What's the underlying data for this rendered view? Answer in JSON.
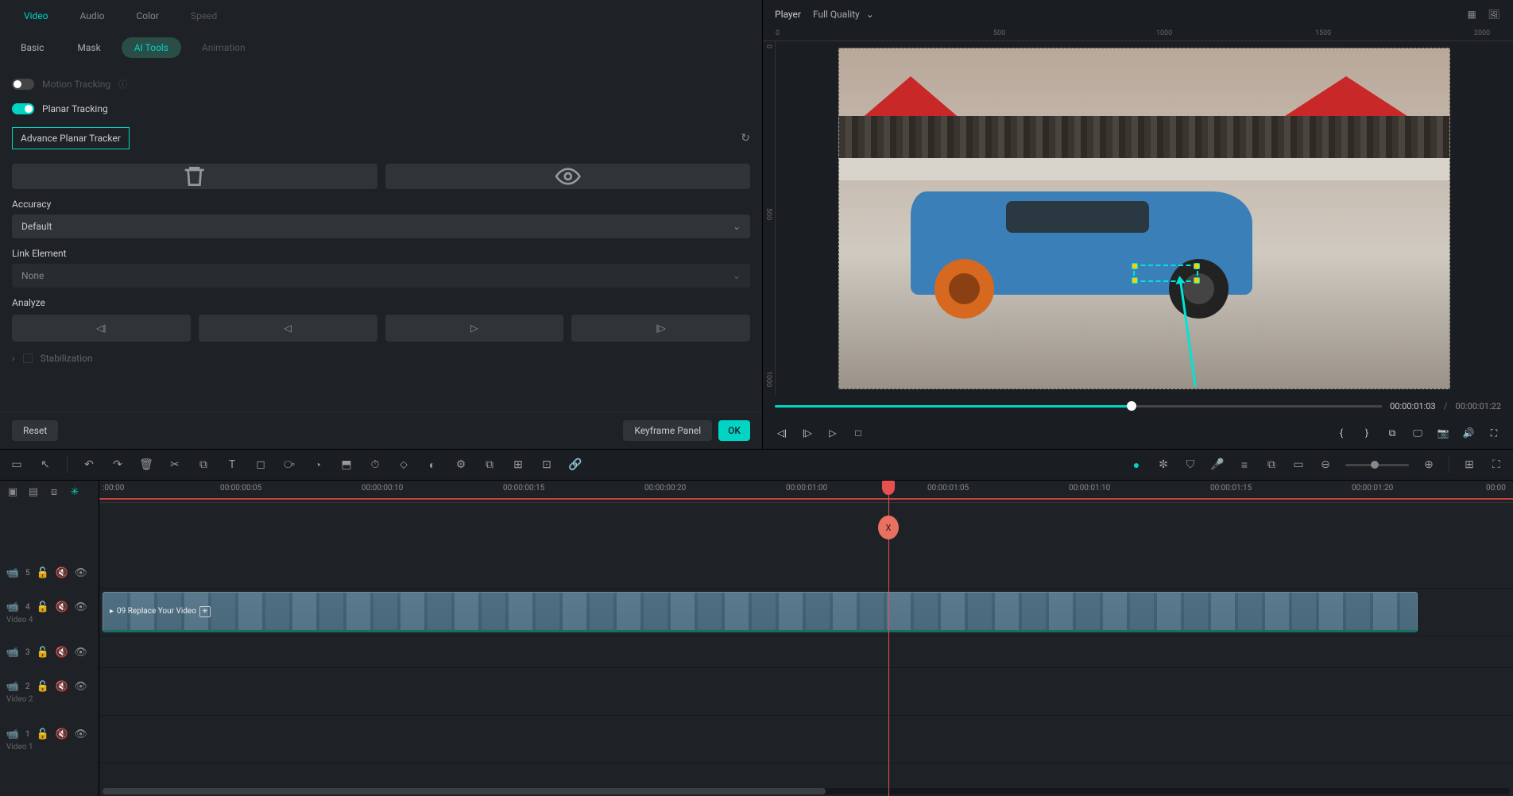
{
  "main_tabs": {
    "video": "Video",
    "audio": "Audio",
    "color": "Color",
    "speed": "Speed"
  },
  "sub_tabs": {
    "basic": "Basic",
    "mask": "Mask",
    "ai_tools": "AI Tools",
    "animation": "Animation"
  },
  "tracking": {
    "motion_label": "Motion Tracking",
    "planar_label": "Planar Tracking",
    "tracker_name": "Advance Planar Tracker"
  },
  "accuracy": {
    "label": "Accuracy",
    "value": "Default"
  },
  "link_element": {
    "label": "Link Element",
    "value": "None"
  },
  "analyze": {
    "label": "Analyze"
  },
  "stabilization": {
    "label": "Stabilization"
  },
  "footer": {
    "reset": "Reset",
    "keyframe_panel": "Keyframe Panel",
    "ok": "OK"
  },
  "player": {
    "label": "Player",
    "quality": "Full Quality",
    "current_time": "00:00:01:03",
    "total_time": "00:00:01:22"
  },
  "ruler_h": {
    "t0": "0",
    "t500": "500",
    "t1000": "1000",
    "t1500": "1500",
    "t2000": "2000"
  },
  "ruler_v": {
    "t0": "0",
    "t500": "500",
    "t1000": "1000"
  },
  "timeline": {
    "ticks": {
      "t0": ":00:00",
      "t1": "00:00:00:05",
      "t2": "00:00:00:10",
      "t3": "00:00:00:15",
      "t4": "00:00:00:20",
      "t5": "00:00:01:00",
      "t6": "00:00:01:05",
      "t7": "00:00:01:10",
      "t8": "00:00:01:15",
      "t9": "00:00:01:20",
      "t10": "00:00"
    },
    "marker": "X",
    "tracks": {
      "t5": "5",
      "t4": "4",
      "t3": "3",
      "t2": "2",
      "t1": "1",
      "video4": "Video 4",
      "video2": "Video 2",
      "video1": "Video 1"
    },
    "clip": {
      "label": "09 Replace Your Video"
    }
  },
  "braces": {
    "open": "{",
    "close": "}"
  }
}
